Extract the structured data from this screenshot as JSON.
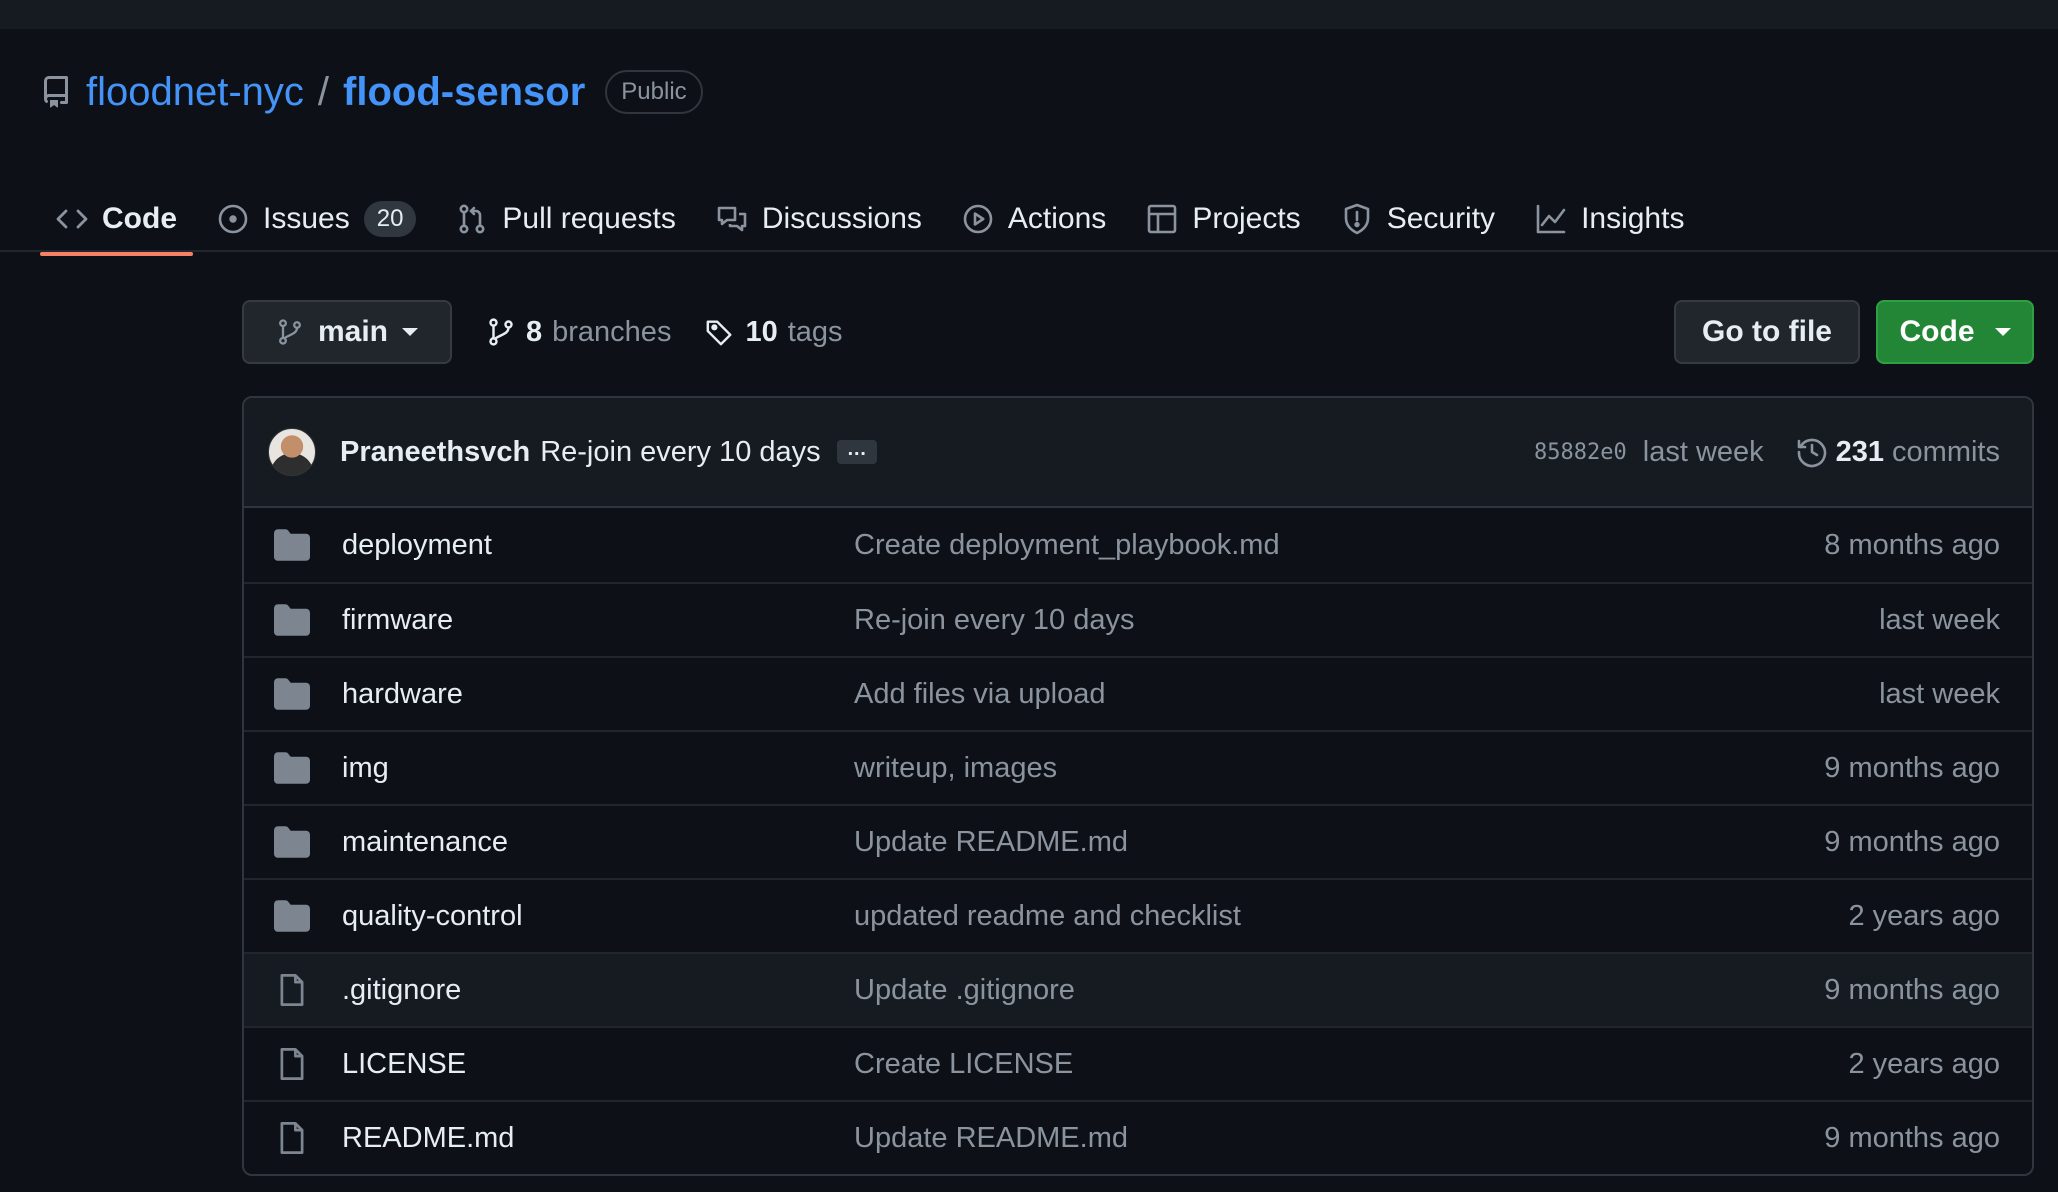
{
  "header": {
    "owner": "floodnet-nyc",
    "separator": "/",
    "repo": "flood-sensor",
    "visibility": "Public"
  },
  "tabs": [
    {
      "label": "Code",
      "icon": "code-icon",
      "active": true
    },
    {
      "label": "Issues",
      "icon": "issue-opened-icon",
      "count": "20"
    },
    {
      "label": "Pull requests",
      "icon": "git-pull-request-icon"
    },
    {
      "label": "Discussions",
      "icon": "comment-discussion-icon"
    },
    {
      "label": "Actions",
      "icon": "play-icon"
    },
    {
      "label": "Projects",
      "icon": "table-icon"
    },
    {
      "label": "Security",
      "icon": "shield-icon"
    },
    {
      "label": "Insights",
      "icon": "graph-icon"
    }
  ],
  "branch_bar": {
    "branch": "main",
    "branches_count": "8",
    "branches_label": "branches",
    "tags_count": "10",
    "tags_label": "tags",
    "go_to_file": "Go to file",
    "code_button": "Code"
  },
  "latest_commit": {
    "author": "Praneethsvch",
    "message": "Re-join every 10 days",
    "ellipsis": "…",
    "sha": "85882e0",
    "time": "last week",
    "commit_count": "231",
    "commits_label": "commits"
  },
  "files": [
    {
      "type": "dir",
      "name": "deployment",
      "message": "Create deployment_playbook.md",
      "time": "8 months ago"
    },
    {
      "type": "dir",
      "name": "firmware",
      "message": "Re-join every 10 days",
      "time": "last week"
    },
    {
      "type": "dir",
      "name": "hardware",
      "message": "Add files via upload",
      "time": "last week"
    },
    {
      "type": "dir",
      "name": "img",
      "message": "writeup, images",
      "time": "9 months ago"
    },
    {
      "type": "dir",
      "name": "maintenance",
      "message": "Update README.md",
      "time": "9 months ago"
    },
    {
      "type": "dir",
      "name": "quality-control",
      "message": "updated readme and checklist",
      "time": "2 years ago"
    },
    {
      "type": "file",
      "name": ".gitignore",
      "message": "Update .gitignore",
      "time": "9 months ago"
    },
    {
      "type": "file",
      "name": "LICENSE",
      "message": "Create LICENSE",
      "time": "2 years ago"
    },
    {
      "type": "file",
      "name": "README.md",
      "message": "Update README.md",
      "time": "9 months ago"
    }
  ],
  "colors": {
    "background": "#0d1117",
    "link": "#4493f8",
    "active_tab_underline": "#f78166",
    "primary_button": "#238636",
    "folder_icon": "#7d8590"
  }
}
